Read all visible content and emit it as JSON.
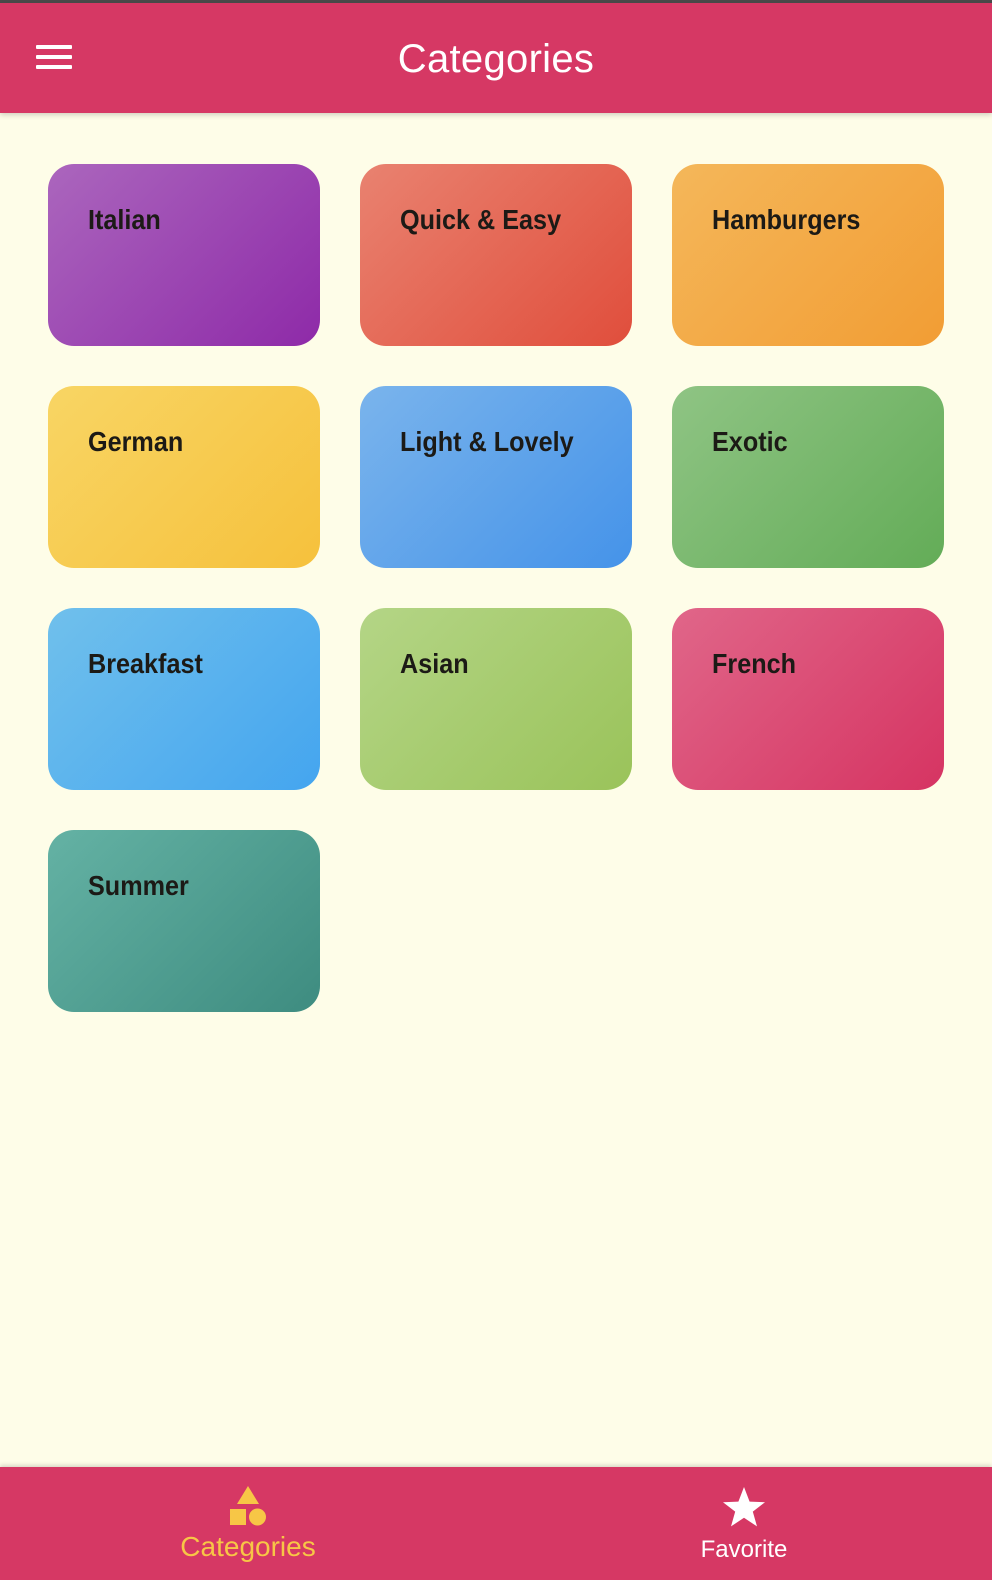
{
  "app_bar": {
    "title": "Categories",
    "menu_icon": "hamburger-menu-icon",
    "background": "#d63864"
  },
  "categories": [
    {
      "label": "Italian",
      "color_start": "#ab66bd",
      "color_end": "#8e2aa8"
    },
    {
      "label": "Quick & Easy",
      "color_start": "#e98270",
      "color_end": "#e04e3c"
    },
    {
      "label": "Hamburgers",
      "color_start": "#f4b75a",
      "color_end": "#f29d34"
    },
    {
      "label": "German",
      "color_start": "#f8d564",
      "color_end": "#f6c13c"
    },
    {
      "label": "Light & Lovely",
      "color_start": "#7ab4ec",
      "color_end": "#4593e9"
    },
    {
      "label": "Exotic",
      "color_start": "#8fc484",
      "color_end": "#63ac57"
    },
    {
      "label": "Breakfast",
      "color_start": "#70c0ec",
      "color_end": "#44a5ef"
    },
    {
      "label": "Asian",
      "color_start": "#b4d586",
      "color_end": "#9ac35a"
    },
    {
      "label": "French",
      "color_start": "#e06689",
      "color_end": "#d63462"
    },
    {
      "label": "Summer",
      "color_start": "#64b2a4",
      "color_end": "#3e8c80"
    }
  ],
  "bottom_nav": {
    "items": [
      {
        "label": "Categories",
        "icon": "category-shapes-icon",
        "active": true,
        "color": "#f7c646"
      },
      {
        "label": "Favorite",
        "icon": "star-icon",
        "active": false,
        "color": "#ffffff"
      }
    ]
  }
}
